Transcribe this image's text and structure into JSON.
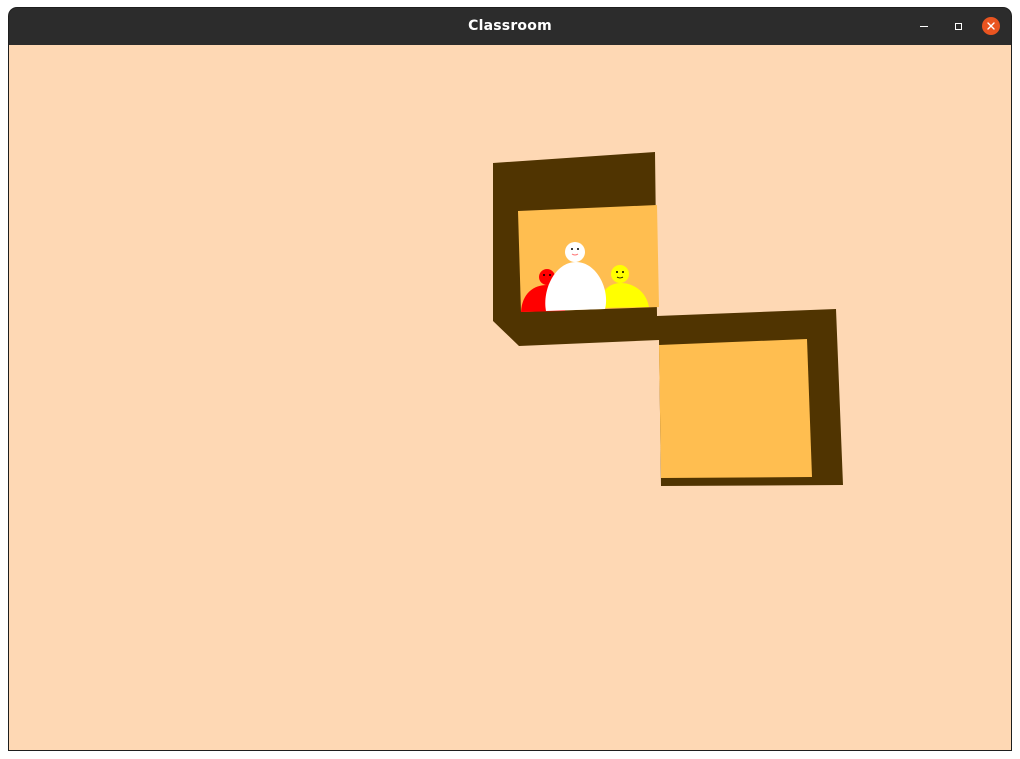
{
  "window": {
    "title": "Classroom"
  },
  "titlebar_buttons": {
    "minimize_icon": "minimize-icon",
    "maximize_icon": "maximize-icon",
    "close_icon": "close-icon"
  },
  "scene": {
    "colors": {
      "background": "#fed8b4",
      "frame": "#503401",
      "panel": "#ffbe50",
      "titlebar": "#2c2c2c",
      "close_button": "#e95420"
    },
    "characters": [
      {
        "name": "red-character",
        "color": "#ff0000"
      },
      {
        "name": "white-character",
        "color": "#ffffff"
      },
      {
        "name": "yellow-character",
        "color": "#ffff00"
      }
    ]
  }
}
